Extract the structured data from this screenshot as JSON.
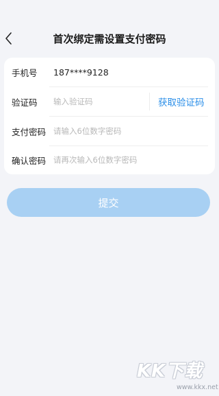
{
  "header": {
    "title": "首次绑定需设置支付密码",
    "back_icon": "chevron-left-icon"
  },
  "form": {
    "phone": {
      "label": "手机号",
      "value": "187****9128"
    },
    "code": {
      "label": "验证码",
      "placeholder": "输入验证码",
      "get_code_label": "获取验证码"
    },
    "pay_password": {
      "label": "支付密码",
      "placeholder": "请输入6位数字密码"
    },
    "confirm_password": {
      "label": "确认密码",
      "placeholder": "请再次输入6位数字密码"
    }
  },
  "submit": {
    "label": "提交"
  },
  "watermark": {
    "main": "KK下载",
    "sub": "www.kkx.net"
  },
  "colors": {
    "background": "#f3f4f8",
    "accent": "#2a8ee8",
    "button_disabled": "#a8d0f3"
  }
}
